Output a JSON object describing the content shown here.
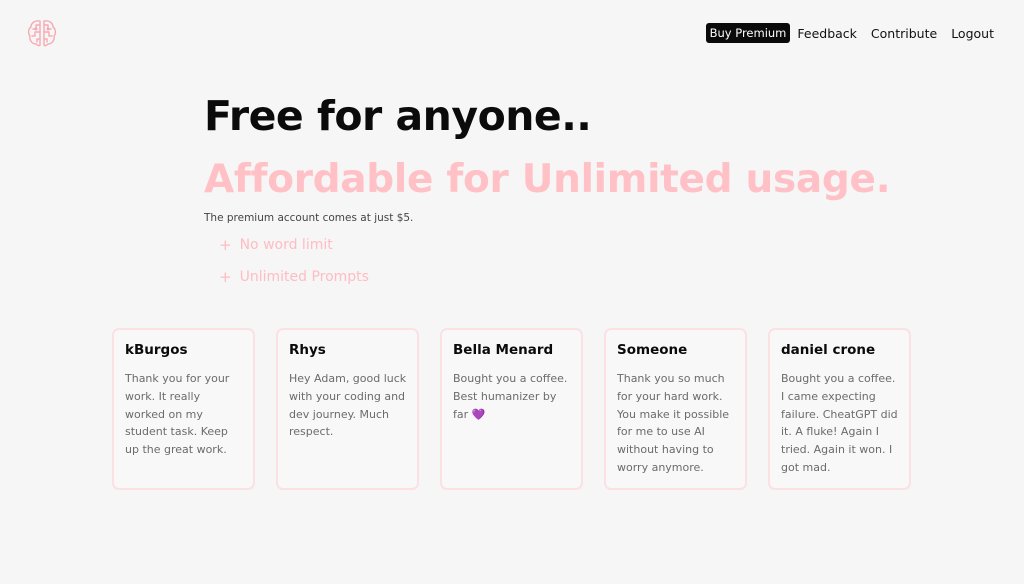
{
  "nav": {
    "buy_premium": "Buy Premium",
    "feedback": "Feedback",
    "contribute": "Contribute",
    "logout": "Logout"
  },
  "hero": {
    "title": "Free for anyone..",
    "subtitle": "Affordable for Unlimited usage.",
    "description": "The premium account comes at just $5.",
    "features": [
      "No word limit",
      "Unlimited Prompts"
    ]
  },
  "testimonials": [
    {
      "name": "kBurgos",
      "text": "Thank you for your work. It really worked on my student task. Keep up the great work."
    },
    {
      "name": "Rhys",
      "text": "Hey Adam, good luck with your coding and dev journey. Much respect."
    },
    {
      "name": "Bella Menard",
      "text": "Bought you a coffee. Best humanizer by far",
      "emoji": "💜"
    },
    {
      "name": "Someone",
      "text": "Thank you so much for your hard work. You make it possible for me to use AI without having to worry anymore."
    },
    {
      "name": "daniel crone",
      "text": "Bought you a coffee. I came expecting failure. CheatGPT did it. A fluke! Again I tried. Again it won. I got mad."
    }
  ],
  "colors": {
    "accent_pink": "#ffc0c6",
    "background": "#f6f6f6",
    "card_border": "#fbe1e4"
  },
  "icons": {
    "logo": "brain-circuit-icon",
    "feature_bullet": "plus-icon"
  }
}
